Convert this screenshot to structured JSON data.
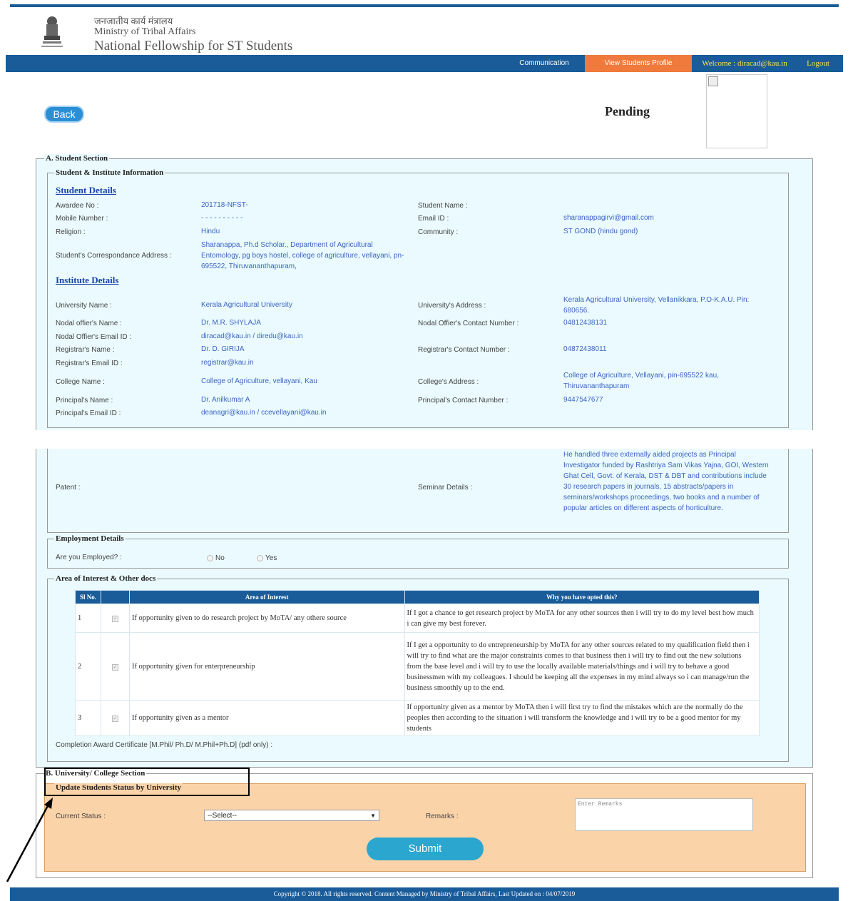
{
  "header": {
    "hindi_line": "जनजातीय कार्य मंत्रालय",
    "ministry": "Ministry of Tribal Affairs",
    "title": "National Fellowship for ST Students"
  },
  "nav": {
    "communication": "Communication",
    "view_profile": "View Students Profile",
    "welcome": "Welcome : diracad@kau.in",
    "logout": "Logout"
  },
  "back_label": "Back",
  "status_title": "Pending",
  "section_a": {
    "legend": "A. Student Section",
    "student_institute_legend": "Student & Institute Information",
    "student_details_link": "Student Details",
    "institute_details_link": "Institute Details",
    "student_fields": {
      "awardee_no_label": "Awardee No :",
      "awardee_no": "201718-NFST-",
      "student_name_label": "Student Name :",
      "mobile_label": "Mobile Number :",
      "mobile": "- - - - - - - - - -",
      "email_label": "Email ID :",
      "email": "sharanappagirvi@gmail.com",
      "religion_label": "Religion :",
      "religion": "Hindu",
      "community_label": "Community :",
      "community": "ST GOND (hindu gond)",
      "address_label": "Student's Correspondance Address :",
      "address": "Sharanappa, Ph.d Scholar., Department of Agricultural Entomology, pg boys hostel, college of agriculture, vellayani, pn-695522, Thiruvananthapuram,"
    },
    "institute_fields": {
      "university_name_label": "University Name :",
      "university_name": "Kerala Agricultural University",
      "university_address_label": "University's Address :",
      "university_address": "Kerala Agricultural University, Vellanikkara, P.O-K.A.U. Pin: 680656.",
      "nodal_name_label": "Nodal offier's Name :",
      "nodal_name": "Dr. M.R. SHYLAJA",
      "nodal_contact_label": "Nodal Offier's Contact Number :",
      "nodal_contact": "04812438131",
      "nodal_email_label": "Nodal Offier's Email ID :",
      "nodal_email": "diracad@kau.in / diredu@kau.in",
      "registrar_name_label": "Registrar's Name :",
      "registrar_name": "Dr. D. GIRIJA",
      "registrar_contact_label": "Registrar's Contact Number :",
      "registrar_contact": "04872438011",
      "registrar_email_label": "Registrar's Email ID :",
      "registrar_email": "registrar@kau.in",
      "college_name_label": "College Name :",
      "college_name": "College of Agriculture, vellayani, Kau",
      "college_address_label": "College's Address :",
      "college_address": "College of Agriculture, Vellayani, pin-695522 kau, Thiruvananthapuram",
      "principal_name_label": "Principal's Name :",
      "principal_name": "Dr. Anilkumar A",
      "principal_contact_label": "Principal's Contact Number :",
      "principal_contact": "9447547677",
      "principal_email_label": "Principal's Email ID :",
      "principal_email": "deanagri@kau.in / ccevellayani@kau.in"
    },
    "patent_label": "Patent :",
    "seminar_label": "Seminar Details :",
    "seminar_details": "He handled three externally aided projects as Principal Investigator funded by Rashtriya Sam Vikas Yajna, GOI, Western Ghat Cell, Govt. of Kerala, DST & DBT and contributions include 30 research papers in journals, 15 abstracts/papers in seminars/workshops proceedings, two books and a number of popular articles on different aspects of horticulture.",
    "employment_legend": "Employment Details",
    "employed_question": "Are you Employed? :",
    "employed_no": "No",
    "employed_yes": "Yes",
    "area_legend": "Area of Interest & Other docs",
    "table_headers": [
      "Sl No.",
      "Area of Interest",
      "Why you have opted this?"
    ],
    "table_rows": [
      {
        "no": "1",
        "area": "If opportunity given to do research project by MoTA/ any othere source",
        "why": "If I got a chance to get research project by MoTA for any other sources then i will try to do my level best how much i can give my best forever."
      },
      {
        "no": "2",
        "area": "If opportunity given for enterpreneurship",
        "why": "If I get a opportunity to do entrepreneurship by MoTA for any other sources related to my qualification field then i will try to find what are the major constraints comes to that business then i will try to find out the new solutions from the base level and i will try to use the locally available materials/things and i will try to behave a good businessmen with my colleagues. I should be keeping all the expenses in my mind always so i can manage/run the business smoothly up to the end."
      },
      {
        "no": "3",
        "area": "If opportunity given as a mentor",
        "why": "If opportunity given as a mentor by MoTA then i will first try to find the mistakes which are the normally do the peoples then according to the situation i will transform the knowledge and i will try to be a good mentor for my students"
      }
    ],
    "completion_label": "Completion Award Certificate [M.Phil/ Ph.D/ M.Phil+Ph.D] (pdf only) :"
  },
  "section_b": {
    "legend": "B. University/ College Section",
    "update_legend": "Update Students Status by University",
    "current_status_label": "Current Status :",
    "current_status_value": "--Select--",
    "remarks_label": "Remarks :",
    "remarks_placeholder": "Enter Remarks",
    "submit_label": "Submit"
  },
  "footer": "Copyright © 2018. All rights reserved. Content Managed by Ministry of Tribal Affairs, Last Updated on : 04/07/2019"
}
